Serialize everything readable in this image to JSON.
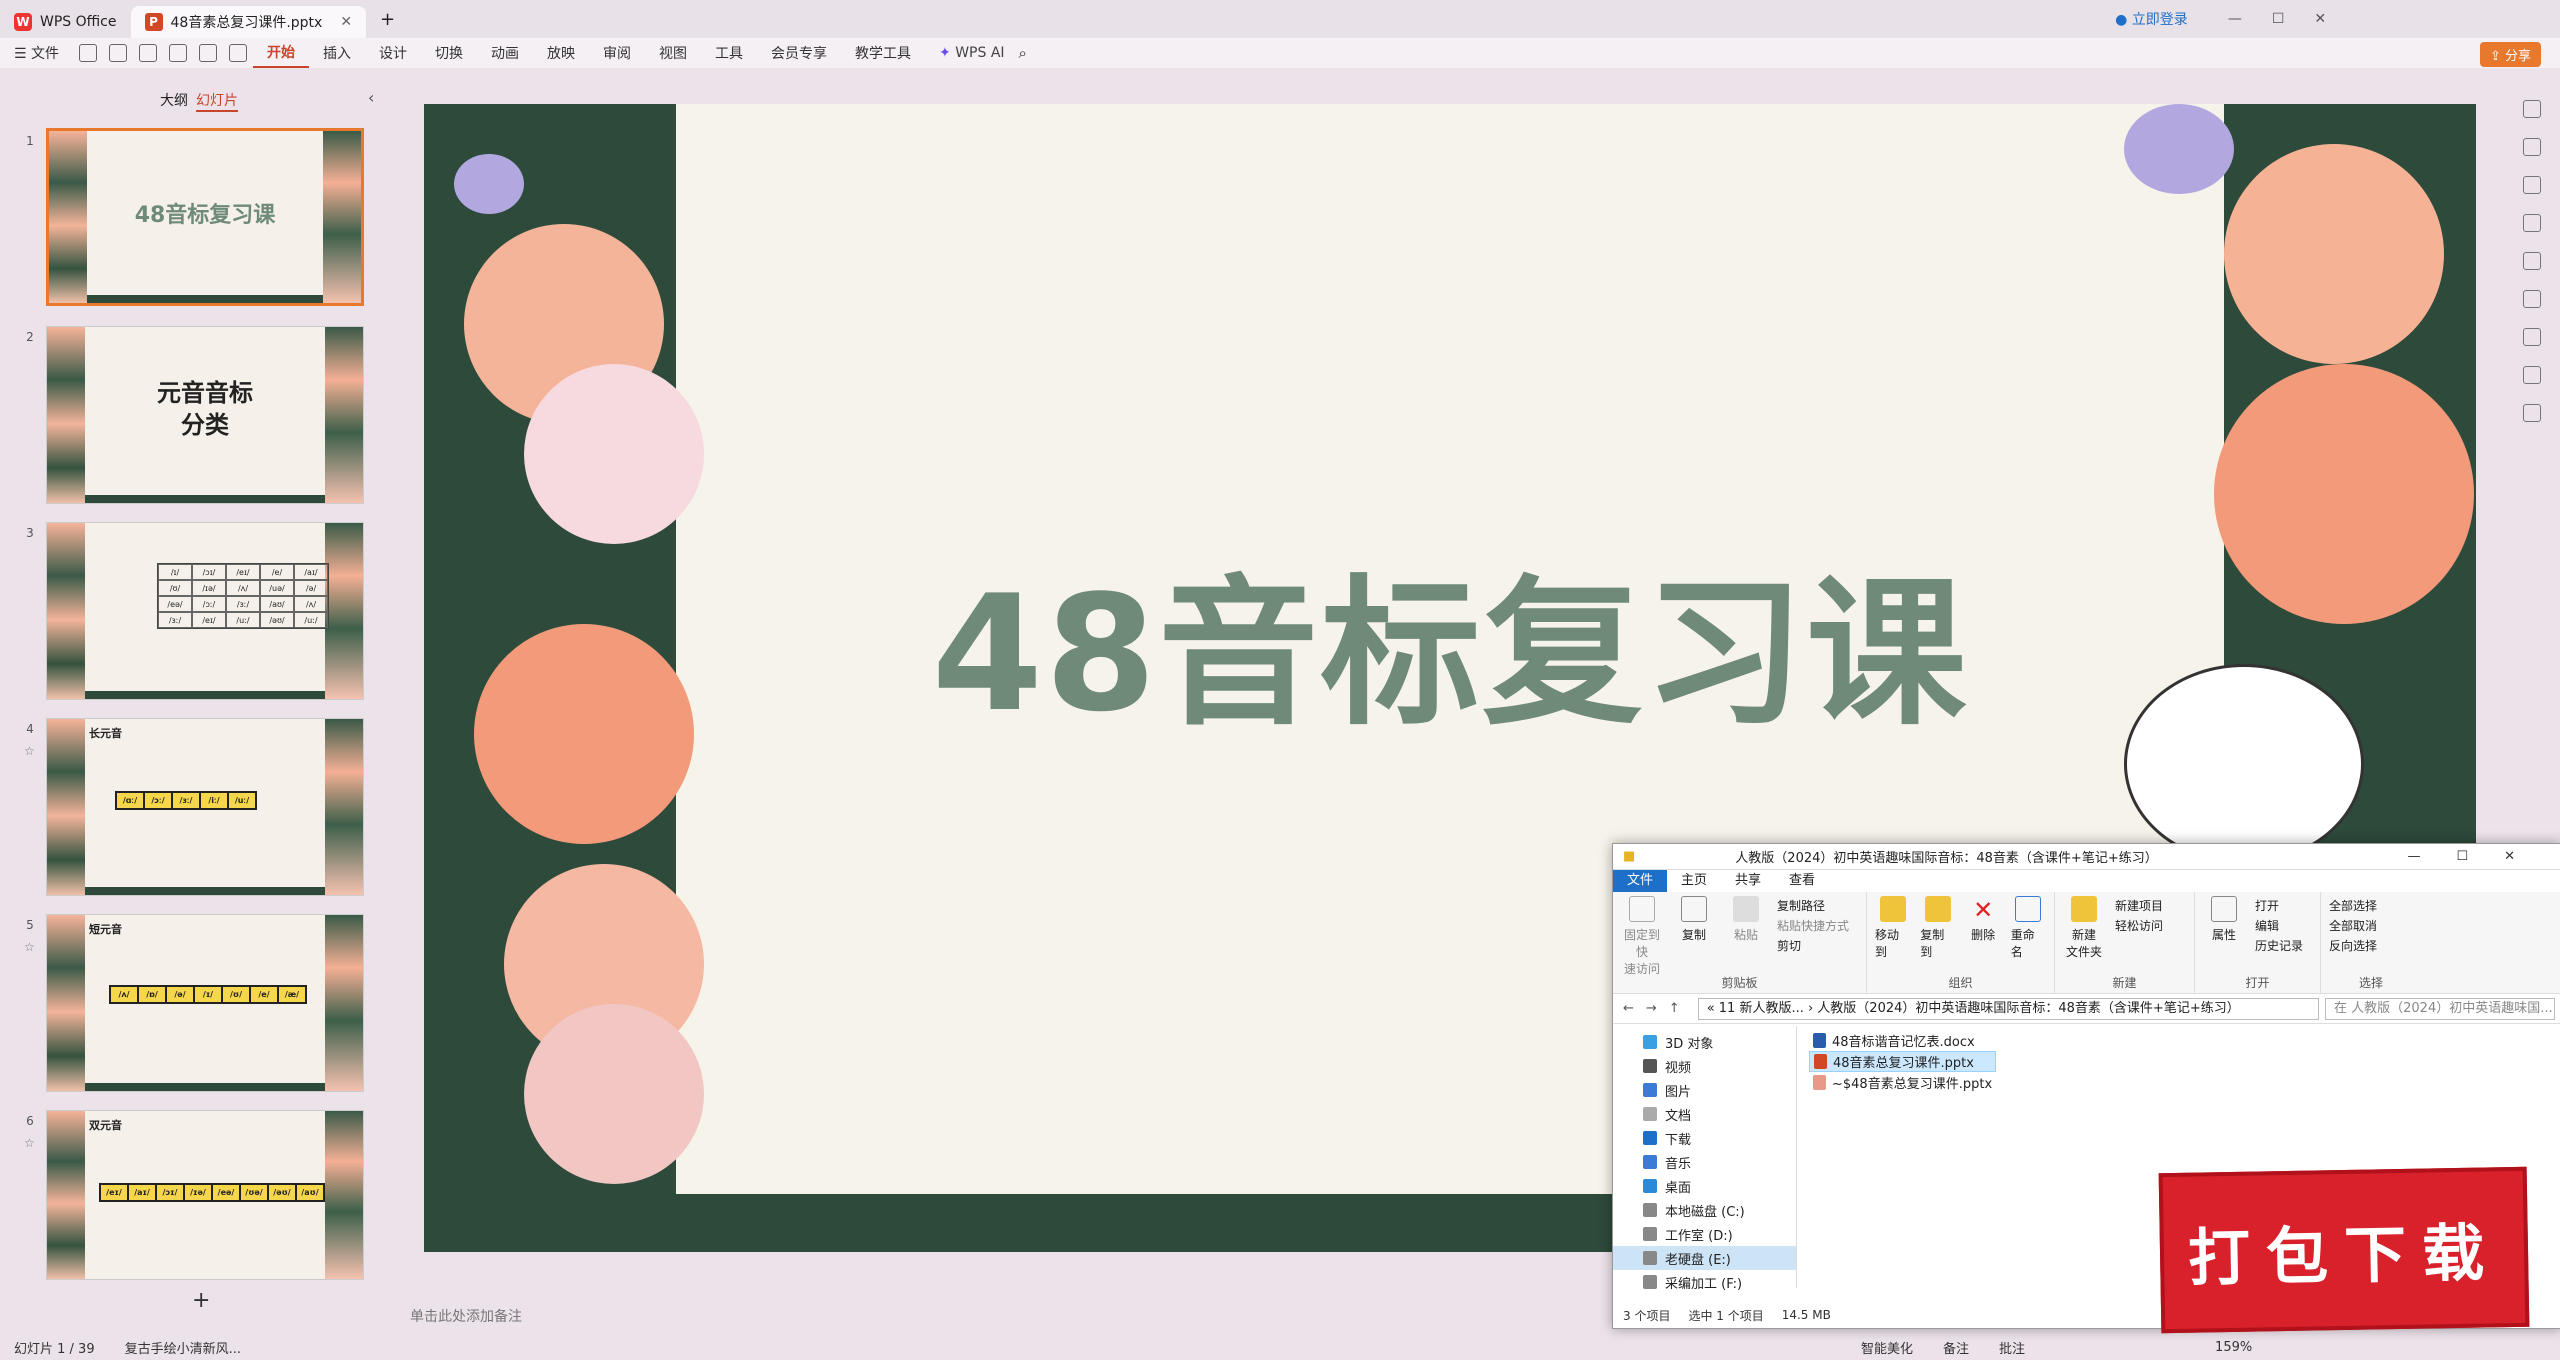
{
  "titlebar": {
    "tabs": [
      {
        "label": "WPS Office"
      },
      {
        "label": "48音素总复习课件.pptx"
      }
    ],
    "login": "立即登录"
  },
  "menubar": {
    "file": "文件",
    "items": [
      "开始",
      "插入",
      "设计",
      "切换",
      "动画",
      "放映",
      "审阅",
      "视图",
      "工具",
      "会员专享",
      "教学工具"
    ],
    "ai": "WPS AI",
    "share": "分享"
  },
  "leftpanel": {
    "tabs": [
      "大纲",
      "幻灯片"
    ],
    "slides": [
      {
        "num": "1",
        "title": "48音标复习课"
      },
      {
        "num": "2",
        "title": "元音音标\n分类"
      },
      {
        "num": "3",
        "title": "",
        "grid": [
          "/ɪ/",
          "/ɔɪ/",
          "/eɪ/",
          "/e/",
          "/aɪ/",
          "/ʊ/",
          "/ɪə/",
          "/ʌ/",
          "/uə/",
          "/ə/",
          "/eə/",
          "/ɔː/",
          "/ɜː/",
          "/aʊ/",
          "/ʌ/",
          "/ɜː/",
          "/eɪ/",
          "/uː/",
          "/əʊ/",
          "/uː/"
        ]
      },
      {
        "num": "4",
        "label": "长元音",
        "chips": [
          "/ɑː/",
          "/ɔː/",
          "/ɜː/",
          "/iː/",
          "/uː/"
        ]
      },
      {
        "num": "5",
        "label": "短元音",
        "chips": [
          "/ʌ/",
          "/ɒ/",
          "/ə/",
          "/ɪ/",
          "/ʊ/",
          "/e/",
          "/æ/"
        ]
      },
      {
        "num": "6",
        "label": "双元音",
        "chips": [
          "/eɪ/",
          "/aɪ/",
          "/ɔɪ/",
          "/ɪə/",
          "/eə/",
          "/ʊə/",
          "/əʊ/",
          "/aʊ/"
        ]
      }
    ],
    "add": "+"
  },
  "slide": {
    "title": "48音标复习课",
    "notes_placeholder": "单击此处添加备注"
  },
  "statusbar": {
    "slide_count": "幻灯片 1 / 39",
    "theme": "复古手绘小清新风...",
    "beautify": "智能美化",
    "notes": "备注",
    "comments": "批注",
    "zoom": "159%"
  },
  "explorer": {
    "title": "人教版（2024）初中英语趣味国际音标：48音素（含课件+笔记+练习）",
    "tabs": [
      "文件",
      "主页",
      "共享",
      "查看"
    ],
    "ribbon": {
      "clipboard": {
        "pin": "固定到快\n速访问",
        "copy": "复制",
        "paste": "粘贴",
        "copy_path": "复制路径",
        "paste_shortcut": "粘贴快捷方式",
        "cut": "剪切",
        "name": "剪贴板"
      },
      "organize": {
        "move": "移动到",
        "copyto": "复制到",
        "delete": "删除",
        "rename": "重命名",
        "name": "组织"
      },
      "new": {
        "new_folder": "新建\n文件夹",
        "new_item": "新建项目",
        "easy_access": "轻松访问",
        "name": "新建"
      },
      "open": {
        "properties": "属性",
        "open": "打开",
        "edit": "编辑",
        "history": "历史记录",
        "name": "打开"
      },
      "select": {
        "all": "全部选择",
        "none": "全部取消",
        "invert": "反向选择",
        "name": "选择"
      }
    },
    "path": "« 11 新人教版... › 人教版（2024）初中英语趣味国际音标：48音素（含课件+笔记+练习）",
    "search_placeholder": "在 人教版（2024）初中英语趣味国...",
    "nav": [
      "3D 对象",
      "视频",
      "图片",
      "文档",
      "下载",
      "音乐",
      "桌面",
      "本地磁盘 (C:)",
      "工作室 (D:)",
      "老硬盘 (E:)",
      "采编加工 (F:)"
    ],
    "files": [
      "48音标谐音记忆表.docx",
      "48音素总复习课件.pptx",
      "~$48音素总复习课件.pptx"
    ],
    "status": {
      "count": "3 个项目",
      "selected": "选中 1 个项目",
      "size": "14.5 MB"
    }
  },
  "promo": {
    "text": "打包下载"
  },
  "colors": {
    "accent": "#c8452c",
    "slide_bg": "#f6f3ea",
    "slide_frame": "#2d4a3b",
    "title_green": "#6f8a79",
    "promo_red": "#d9212c"
  }
}
